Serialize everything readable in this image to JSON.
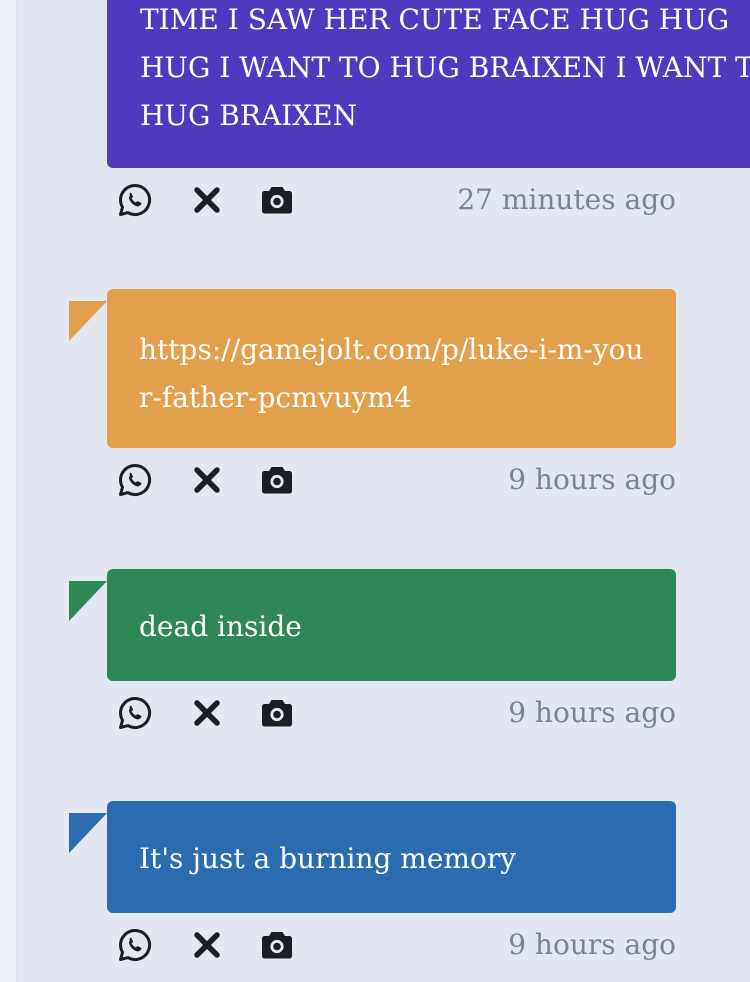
{
  "colors": {
    "purple": "#5039bf",
    "orange": "#e3a04c",
    "green": "#2f8757",
    "blue": "#2b6cb0",
    "timestamp": "#7a8494",
    "icon": "#1b1f24"
  },
  "posts": [
    {
      "text": "TIME I SAW HER CUTE FACE HUG HUG HUG I WANT TO HUG BRAIXEN I WANT TO HUG BRAIXEN",
      "timestamp": "27 minutes ago",
      "icons": [
        "whatsapp-icon",
        "x-icon",
        "camera-icon"
      ]
    },
    {
      "text": "https://gamejolt.com/p/luke-i-m-your-father-pcmvuym4",
      "timestamp": "9 hours ago",
      "icons": [
        "whatsapp-icon",
        "x-icon",
        "camera-icon"
      ]
    },
    {
      "text": "dead inside",
      "timestamp": "9 hours ago",
      "icons": [
        "whatsapp-icon",
        "x-icon",
        "camera-icon"
      ]
    },
    {
      "text": "It's just a burning memory",
      "timestamp": "9 hours ago",
      "icons": [
        "whatsapp-icon",
        "x-icon",
        "camera-icon"
      ]
    }
  ]
}
